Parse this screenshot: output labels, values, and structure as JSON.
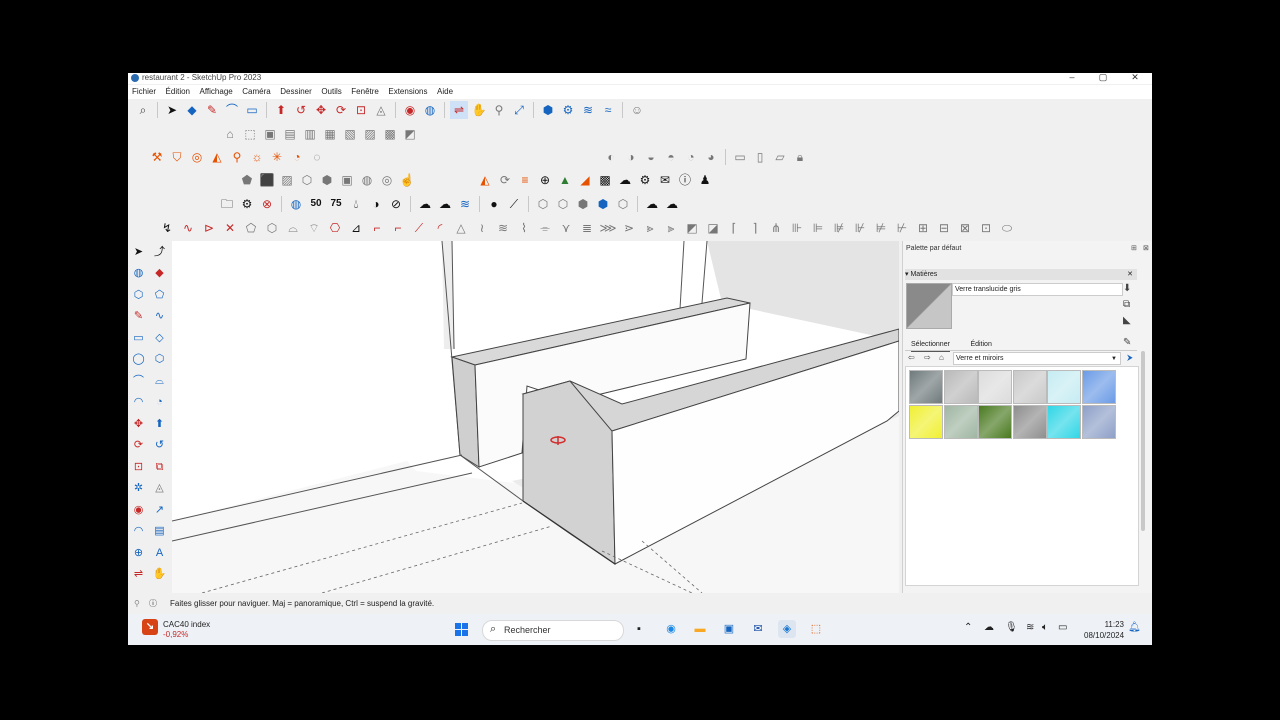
{
  "window": {
    "title": "restaurant 2 - SketchUp Pro 2023",
    "controls": [
      "–",
      "▢",
      "✕"
    ]
  },
  "menu": [
    "Fichier",
    "Édition",
    "Affichage",
    "Caméra",
    "Dessiner",
    "Outils",
    "Fenêtre",
    "Extensions",
    "Aide"
  ],
  "toolbars": {
    "numeric_icons": [
      "50",
      "75"
    ]
  },
  "tray_panel": {
    "title": "Palette par défaut",
    "materials": {
      "header": "Matières",
      "current_name": "Verre translucide gris",
      "tabs": [
        "Sélectionner",
        "Édition"
      ],
      "active_tab": "Sélectionner",
      "library": "Verre et miroirs",
      "swatches": [
        {
          "name": "grille-sombre",
          "color": "#6f7a7c"
        },
        {
          "name": "gris-degrade",
          "color": "#b9b9b9"
        },
        {
          "name": "blanc-degrade",
          "color": "#dcdcdc"
        },
        {
          "name": "texture-granite",
          "color": "#c9c9c9"
        },
        {
          "name": "cyan-quadrille",
          "color": "#c5ecf2"
        },
        {
          "name": "bleu-clair",
          "color": "#6b9be6"
        },
        {
          "name": "jaune",
          "color": "#f0f032"
        },
        {
          "name": "vert-strie",
          "color": "#9fb6a2"
        },
        {
          "name": "vert-fonce",
          "color": "#4a7a20"
        },
        {
          "name": "gris-moyen",
          "color": "#8e8e8e"
        },
        {
          "name": "cyan-vif",
          "color": "#30d6e6"
        },
        {
          "name": "bleu-nuageux",
          "color": "#8ea0c8"
        }
      ]
    }
  },
  "status": {
    "message": "Faites glisser pour naviguer. Maj = panoramique, Ctrl =  suspend la gravité."
  },
  "taskbar": {
    "widget_name": "CAC40 index",
    "widget_change": "-0,92%",
    "search_placeholder": "Rechercher",
    "time": "11:23",
    "date": "08/10/2024"
  }
}
